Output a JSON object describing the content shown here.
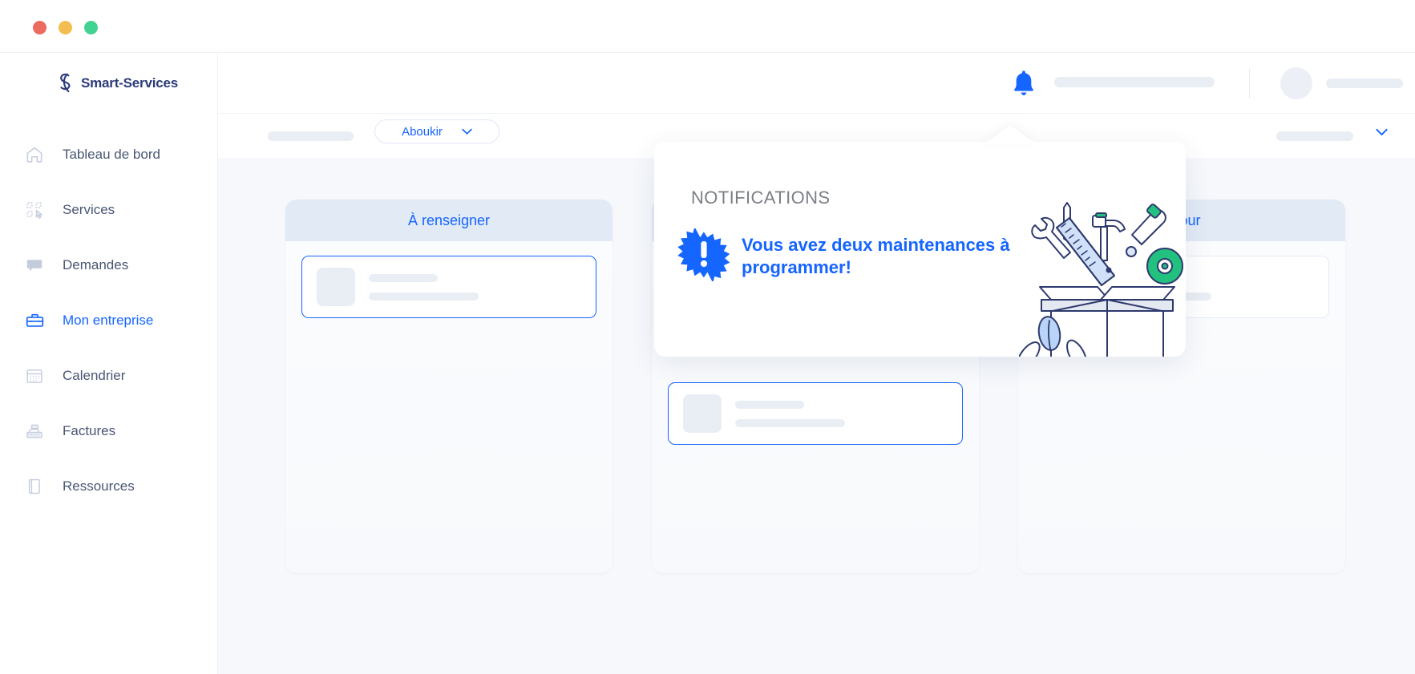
{
  "window": {
    "traffic_lights": [
      "close",
      "minimize",
      "maximize"
    ],
    "colors": {
      "close": "#ec6a5e",
      "minimize": "#f4bd4f",
      "maximize": "#42d392"
    }
  },
  "brand": {
    "name": "Smart-Services",
    "icon": "smart-services-logo-icon",
    "color": "#2b3a7a"
  },
  "sidebar": {
    "items": [
      {
        "label": "Tableau de bord",
        "icon": "home-icon",
        "active": false
      },
      {
        "label": "Services",
        "icon": "services-icon",
        "active": false
      },
      {
        "label": "Demandes",
        "icon": "chat-bubble-icon",
        "active": false
      },
      {
        "label": "Mon entreprise",
        "icon": "briefcase-icon",
        "active": true
      },
      {
        "label": "Calendrier",
        "icon": "calendar-icon",
        "active": false
      },
      {
        "label": "Factures",
        "icon": "cash-register-icon",
        "active": false
      },
      {
        "label": "Ressources",
        "icon": "book-icon",
        "active": false
      }
    ],
    "active_color": "#1565ff",
    "inactive_color": "#495674"
  },
  "topbar": {
    "bell_icon": "notification-bell-icon",
    "bell_color": "#1565ff",
    "user_name_placeholder": "",
    "avatar": "user-avatar",
    "user_label_placeholder": ""
  },
  "subheader": {
    "left_placeholder": "",
    "site_select": {
      "label": "Aboukir",
      "icon": "chevron-down-icon",
      "color": "#1565ff"
    },
    "right_placeholder": "",
    "right_icon": "chevron-down-icon"
  },
  "board": {
    "background": "#f6f8fc",
    "columns": [
      {
        "title": "À renseigner",
        "header_bg": "#e2eaf6",
        "title_color": "#1565ff",
        "cards": [
          {
            "selected": true,
            "thumb": "placeholder-thumb",
            "line1": "",
            "line2": ""
          }
        ]
      },
      {
        "title": "",
        "header_bg": "#e2eaf6",
        "title_color": "#1565ff",
        "cards": [
          {
            "selected": true,
            "thumb": "placeholder-thumb",
            "line1": "",
            "line2": ""
          }
        ]
      },
      {
        "title": "À jour",
        "header_bg": "#e2eaf6",
        "title_color": "#1565ff",
        "cards": [
          {
            "selected": false,
            "thumb": "placeholder-thumb",
            "line1": "",
            "line2": ""
          }
        ]
      }
    ]
  },
  "notifications_popup": {
    "title": "NOTIFICATIONS",
    "title_color": "#7c7f86",
    "message": "Vous avez deux maintenances à programmer!",
    "message_color": "#1565ff",
    "badge_icon": "exclamation-burst-icon",
    "illustration": "toolbox-tools-illustration"
  }
}
